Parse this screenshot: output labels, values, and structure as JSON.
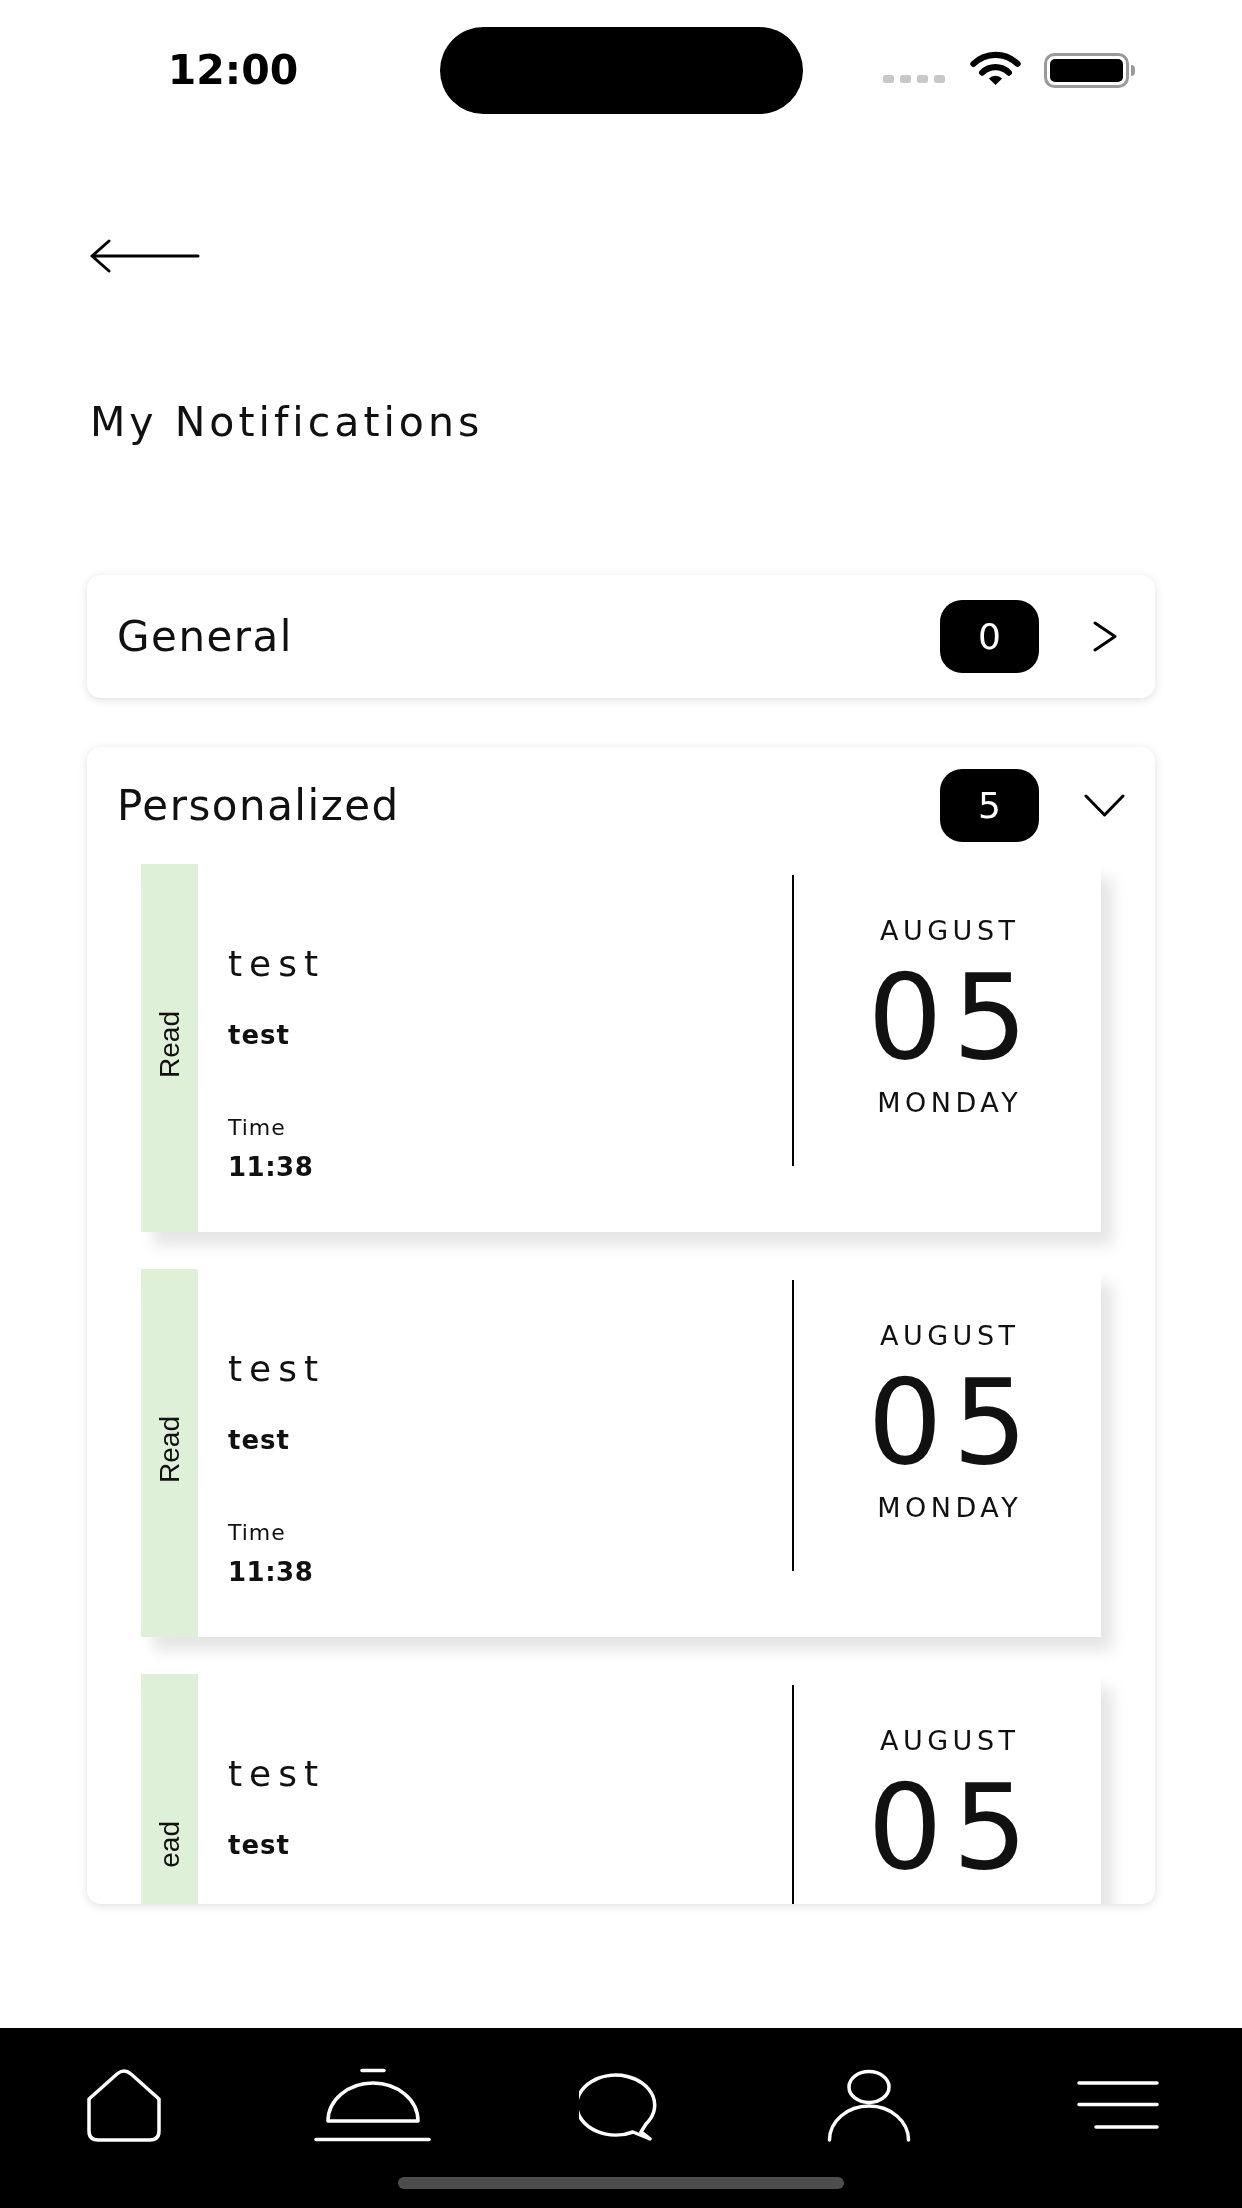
{
  "status_bar": {
    "time": "12:00"
  },
  "header": {
    "title": "My Notifications"
  },
  "sections": [
    {
      "title": "General",
      "count": "0",
      "expanded": false
    },
    {
      "title": "Personalized",
      "count": "5",
      "expanded": true,
      "notifications": [
        {
          "status": "Read",
          "title": "test",
          "body": "test",
          "time_label": "Time",
          "time": "11:38",
          "month": "AUGUST",
          "day": "05",
          "weekday": "MONDAY"
        },
        {
          "status": "Read",
          "title": "test",
          "body": "test",
          "time_label": "Time",
          "time": "11:38",
          "month": "AUGUST",
          "day": "05",
          "weekday": "MONDAY"
        },
        {
          "status": "ead",
          "title": "test",
          "body": "test",
          "month": "AUGUST",
          "day": "05"
        }
      ]
    }
  ]
}
